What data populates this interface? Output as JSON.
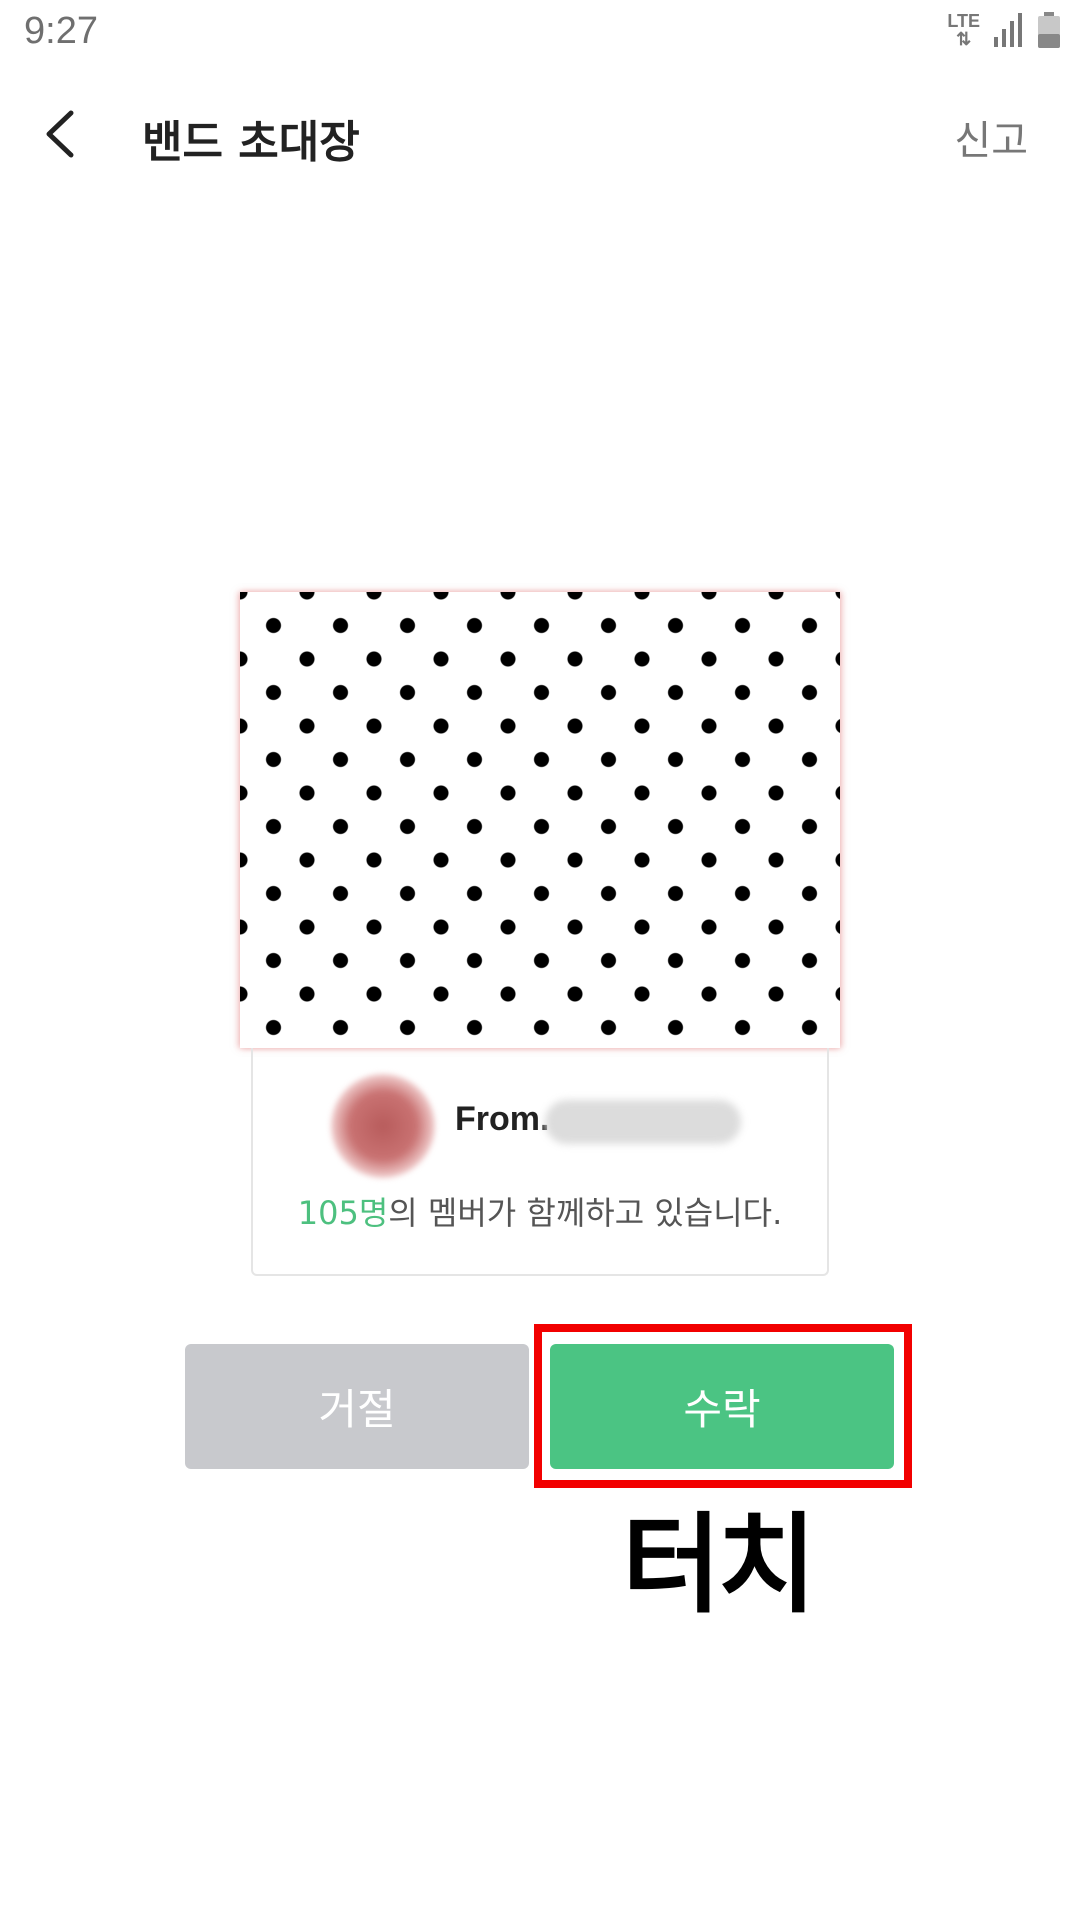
{
  "status_bar": {
    "time": "9:27",
    "network": "LTE"
  },
  "header": {
    "back_icon": "chevron-left-icon",
    "title": "밴드 초대장",
    "report_label": "신고"
  },
  "invitation": {
    "from_label": "From.",
    "member_count": "105명",
    "member_suffix": "의 멤버가 함께하고 있습니다."
  },
  "actions": {
    "decline_label": "거절",
    "accept_label": "수락"
  },
  "annotation": {
    "label": "터치",
    "highlight_color": "#f20000"
  },
  "colors": {
    "accent": "#4bc483",
    "decline_bg": "#c8c9cd"
  }
}
